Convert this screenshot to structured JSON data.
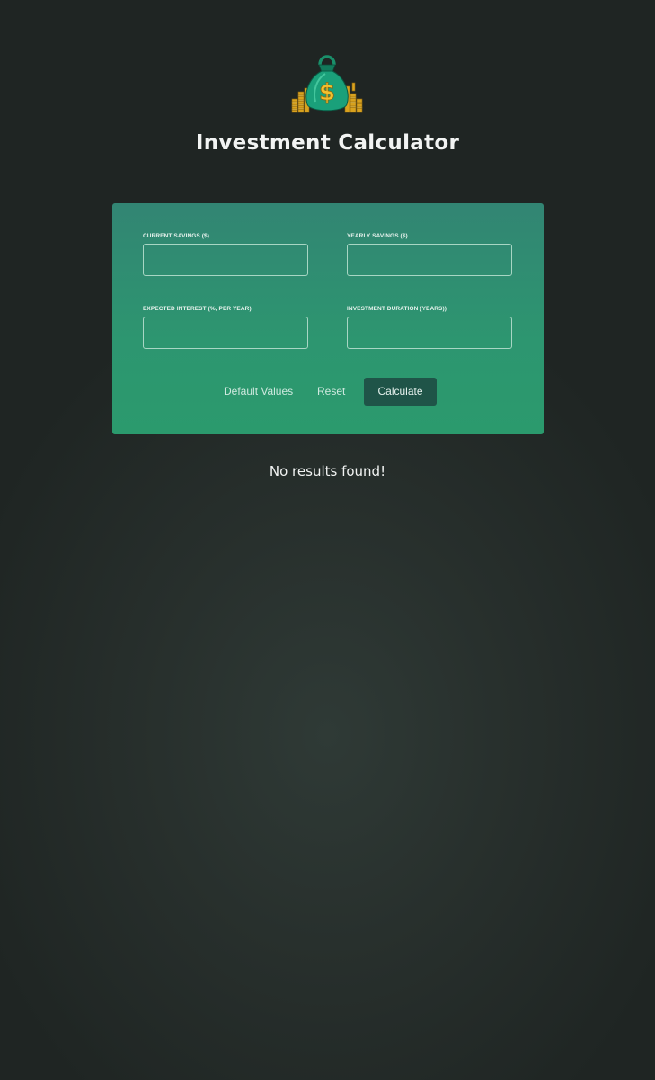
{
  "header": {
    "title": "Investment Calculator",
    "logo_icon": "money-bag-icon"
  },
  "form": {
    "fields": [
      {
        "label": "CURRENT SAVINGS ($)",
        "value": "",
        "placeholder": ""
      },
      {
        "label": "YEARLY SAVINGS ($)",
        "value": "",
        "placeholder": ""
      },
      {
        "label": "EXPECTED INTEREST (%, PER YEAR)",
        "value": "",
        "placeholder": ""
      },
      {
        "label": "INVESTMENT DURATION (YEARS))",
        "value": "",
        "placeholder": ""
      }
    ],
    "actions": {
      "default_values_label": "Default Values",
      "reset_label": "Reset",
      "calculate_label": "Calculate"
    }
  },
  "results": {
    "empty_message": "No results found!"
  },
  "colors": {
    "background": "#28302d",
    "panel_top": "#328573",
    "panel_bottom": "#2b9a6d",
    "calculate_button": "#1f5448",
    "gold": "#e8b423"
  }
}
